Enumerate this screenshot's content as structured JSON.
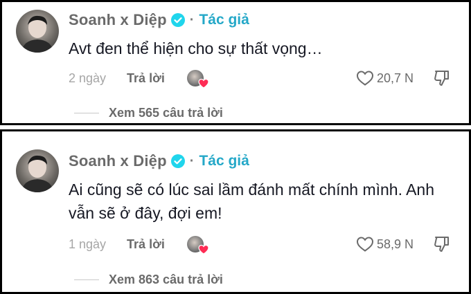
{
  "comments": [
    {
      "author": "Soanh x Diệp",
      "separator": "·",
      "author_badge": "Tác giả",
      "text": "Avt đen thể hiện cho sự thất vọng…",
      "time": "2 ngày",
      "reply_label": "Trả lời",
      "likes": "20,7 N",
      "view_replies": "Xem 565 câu trả lời"
    },
    {
      "author": "Soanh x Diệp",
      "separator": "·",
      "author_badge": "Tác giả",
      "text": "Ai cũng sẽ có lúc sai lầm đánh mất chính mình. Anh vẫn sẽ ở đây, đợi em!",
      "time": "1 ngày",
      "reply_label": "Trả lời",
      "likes": "58,9 N",
      "view_replies": "Xem 863 câu trả lời"
    }
  ],
  "colors": {
    "author_badge": "#25a8c8",
    "verified": "#20d5ec",
    "liked_heart": "#fe2c55"
  },
  "icons": [
    "verified-icon",
    "heart-outline-icon",
    "thumbs-down-icon",
    "heart-filled-icon"
  ]
}
